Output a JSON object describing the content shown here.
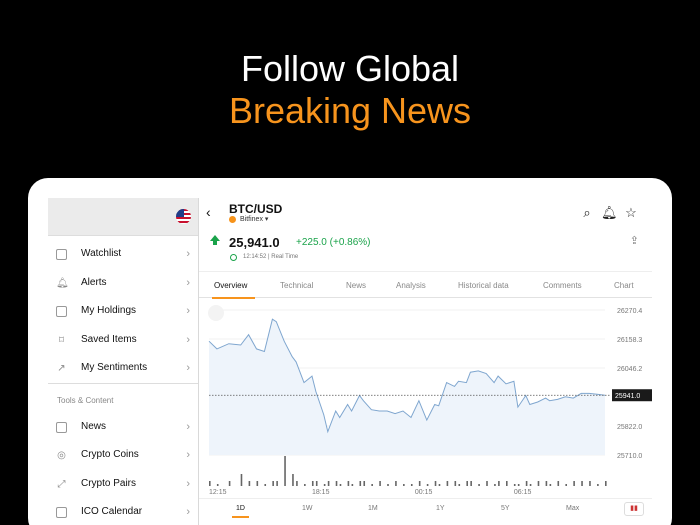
{
  "headline": {
    "line1": "Follow Global",
    "line2": "Breaking News"
  },
  "colors": {
    "accent": "#f7941d",
    "up": "#1aa34a",
    "line": "#7fa6cf",
    "fill": "#eef4fb"
  },
  "sidebar": {
    "flag_icon": "us-flag-icon",
    "items": [
      {
        "label": "Watchlist",
        "icon": "watchlist-icon"
      },
      {
        "label": "Alerts",
        "icon": "bell-icon"
      },
      {
        "label": "My Holdings",
        "icon": "holdings-icon"
      },
      {
        "label": "Saved Items",
        "icon": "bookmark-icon"
      },
      {
        "label": "My Sentiments",
        "icon": "sentiment-icon"
      }
    ],
    "section_title": "Tools & Content",
    "tools": [
      {
        "label": "News",
        "icon": "news-icon"
      },
      {
        "label": "Crypto Coins",
        "icon": "coin-icon"
      },
      {
        "label": "Crypto Pairs",
        "icon": "pairs-icon"
      },
      {
        "label": "ICO Calendar",
        "icon": "calendar-icon"
      }
    ]
  },
  "instrument": {
    "symbol": "BTC/USD",
    "exchange": "Bitfinex",
    "price": "25,941.0",
    "change": "+225.0 (+0.86%)",
    "time": "12:14:52 | Real Time"
  },
  "tabs": [
    "Overview",
    "Technical",
    "News",
    "Analysis",
    "Historical data",
    "Comments",
    "Chart"
  ],
  "ranges": [
    "1D",
    "1W",
    "1M",
    "1Y",
    "5Y",
    "Max"
  ],
  "chart_data": {
    "type": "area",
    "y_ticks": [
      "26270.4",
      "26158.3",
      "26046.2",
      "25941.0",
      "25822.0",
      "25710.0"
    ],
    "x_ticks": [
      "12:15",
      "18:15",
      "00:15",
      "06:15"
    ],
    "ylim": [
      25710.0,
      26270.4
    ],
    "last_price": 25941.0,
    "x": [
      0,
      0.02,
      0.05,
      0.08,
      0.1,
      0.12,
      0.14,
      0.16,
      0.17,
      0.19,
      0.21,
      0.22,
      0.24,
      0.26,
      0.27,
      0.29,
      0.3,
      0.32,
      0.33,
      0.35,
      0.36,
      0.38,
      0.39,
      0.41,
      0.43,
      0.45,
      0.47,
      0.49,
      0.51,
      0.53,
      0.55,
      0.57,
      0.58,
      0.6,
      0.62,
      0.63,
      0.65,
      0.66,
      0.68,
      0.7,
      0.72,
      0.73,
      0.75,
      0.77,
      0.78,
      0.8,
      0.81,
      0.83,
      0.85,
      0.86,
      0.88,
      0.9,
      0.92,
      0.94,
      0.96,
      0.98,
      1.0
    ],
    "values": [
      26150,
      26120,
      26140,
      26135,
      26175,
      26120,
      26110,
      26235,
      26225,
      26150,
      26090,
      26070,
      25990,
      26015,
      25955,
      25865,
      25800,
      25880,
      25855,
      25905,
      25880,
      25940,
      25920,
      25885,
      25880,
      25880,
      25870,
      25880,
      25855,
      25920,
      25845,
      25905,
      25900,
      25990,
      25975,
      25995,
      25990,
      26030,
      26035,
      26025,
      25990,
      26015,
      25985,
      25995,
      25895,
      25940,
      25905,
      25915,
      25930,
      25920,
      25925,
      25935,
      25930,
      25948,
      25948,
      25945,
      25941
    ],
    "volume": [
      1,
      0,
      1,
      2,
      1,
      1,
      0,
      1,
      1,
      3,
      2,
      1,
      0,
      1,
      1,
      0,
      1,
      1,
      0,
      1,
      0,
      1,
      1,
      0,
      1,
      0,
      1,
      0,
      0,
      1,
      0,
      1,
      0,
      1,
      1,
      0,
      1,
      1,
      0,
      1,
      0,
      1,
      1,
      0,
      0,
      1,
      0,
      1,
      1,
      0,
      1,
      0,
      1,
      1,
      1,
      0,
      1
    ]
  }
}
